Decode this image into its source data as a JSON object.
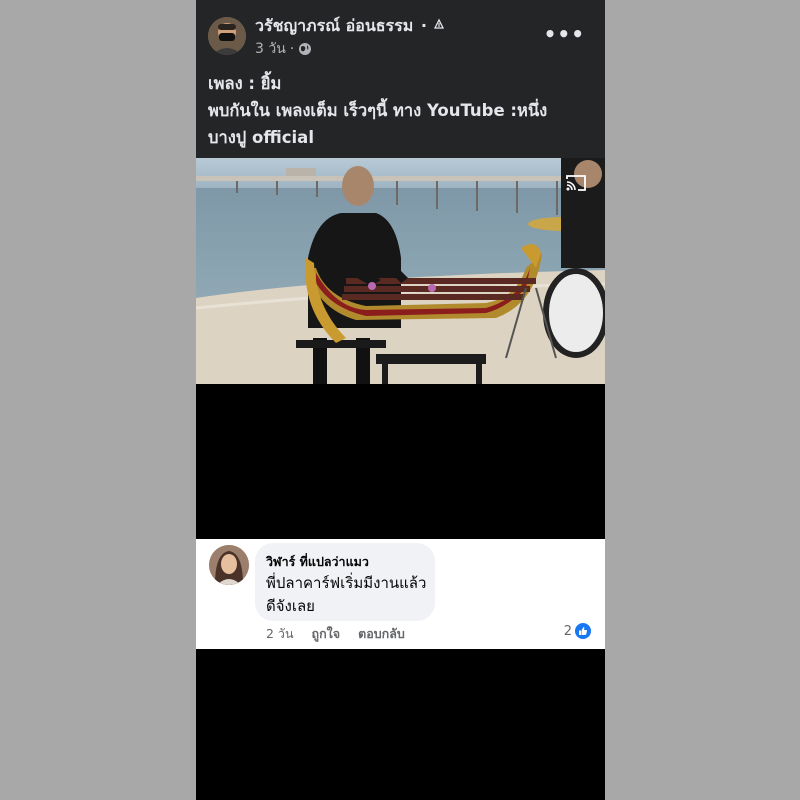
{
  "post": {
    "author": "วรัชญาภรณ์ อ่อนธรรม",
    "author_suffix": "·",
    "time": "3 วัน",
    "audience_icon": "globe-icon",
    "edit_icon": "pen-nib-icon",
    "more_label": "•••",
    "text_lines": [
      "เพลง : ยิ้ม",
      "พบกันใน เพลงเต็ม เร็วๆนี้ ทาง YouTube :หนึ่ง",
      "บางปู official"
    ]
  },
  "video": {
    "cast_icon": "cast-icon"
  },
  "comment": {
    "author": "วิฬาร์ ที่แปลว่าแมว",
    "text_lines": [
      "พี่ปลาคาร์ฟเริ่มมีงานแล้ว",
      "ดีจังเลย"
    ],
    "time": "2 วัน",
    "like_label": "ถูกใจ",
    "reply_label": "ตอบกลับ",
    "reaction_count": "2"
  },
  "colors": {
    "post_bg": "#242526",
    "page_bg": "#a8a8a8",
    "like_blue": "#1877f2",
    "bubble_bg": "#f0f2f5"
  }
}
